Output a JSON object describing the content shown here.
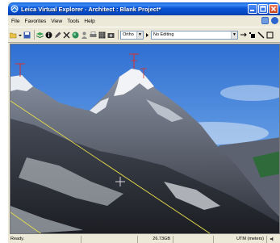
{
  "window": {
    "title": "Leica Virtual Explorer - Architect : Blank Project*"
  },
  "menu": {
    "items": [
      "File",
      "Favorites",
      "View",
      "Tools",
      "Help"
    ]
  },
  "toolbar": {
    "projection_value": "Ortho",
    "editing_value": "No Editing"
  },
  "status": {
    "state": "Ready.",
    "disk": "26.73GB",
    "units": "UTM (meters)"
  },
  "colors": {
    "titlebar": "#0a55d4",
    "chrome": "#ece9d8",
    "sky": "#4a86d9",
    "overlay_line": "#e8e04a",
    "marker": "#d9332b"
  }
}
